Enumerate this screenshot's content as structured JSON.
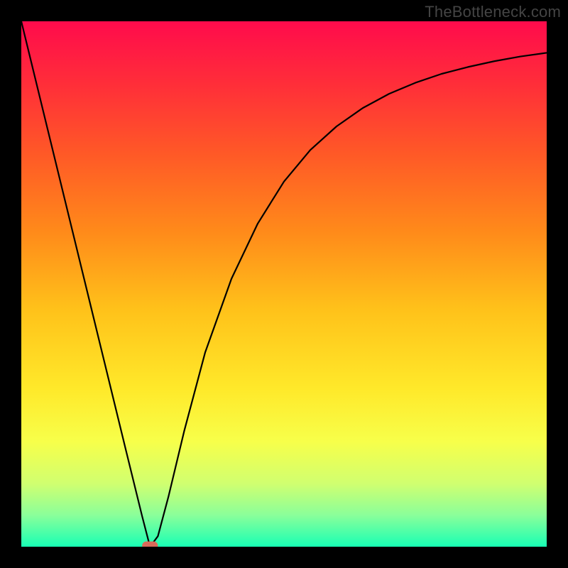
{
  "watermark": "TheBottleneck.com",
  "chart_data": {
    "type": "line",
    "title": "",
    "xlabel": "",
    "ylabel": "",
    "xlim": [
      0,
      1
    ],
    "ylim": [
      0,
      1
    ],
    "background_gradient": {
      "stops": [
        {
          "offset": 0.0,
          "color": "#ff0b4c"
        },
        {
          "offset": 0.12,
          "color": "#ff2e39"
        },
        {
          "offset": 0.25,
          "color": "#ff5827"
        },
        {
          "offset": 0.4,
          "color": "#ff8a1a"
        },
        {
          "offset": 0.55,
          "color": "#ffc21a"
        },
        {
          "offset": 0.7,
          "color": "#ffe92a"
        },
        {
          "offset": 0.8,
          "color": "#f7ff4a"
        },
        {
          "offset": 0.88,
          "color": "#d0ff70"
        },
        {
          "offset": 0.94,
          "color": "#8aff9a"
        },
        {
          "offset": 1.0,
          "color": "#18ffb4"
        }
      ]
    },
    "series": [
      {
        "name": "curve",
        "color": "#000000",
        "x": [
          0.0,
          0.05,
          0.1,
          0.15,
          0.2,
          0.23,
          0.245,
          0.26,
          0.28,
          0.31,
          0.35,
          0.4,
          0.45,
          0.5,
          0.55,
          0.6,
          0.65,
          0.7,
          0.75,
          0.8,
          0.85,
          0.9,
          0.95,
          1.0
        ],
        "y": [
          1.0,
          0.795,
          0.59,
          0.385,
          0.18,
          0.058,
          0.0,
          0.02,
          0.095,
          0.22,
          0.37,
          0.51,
          0.615,
          0.695,
          0.755,
          0.8,
          0.835,
          0.862,
          0.883,
          0.9,
          0.913,
          0.924,
          0.933,
          0.94
        ]
      }
    ],
    "markers": [
      {
        "name": "min-point",
        "shape": "pill",
        "x": 0.245,
        "y": 0.002,
        "width_frac": 0.03,
        "height_frac": 0.016,
        "color": "#d86b5a"
      }
    ]
  }
}
